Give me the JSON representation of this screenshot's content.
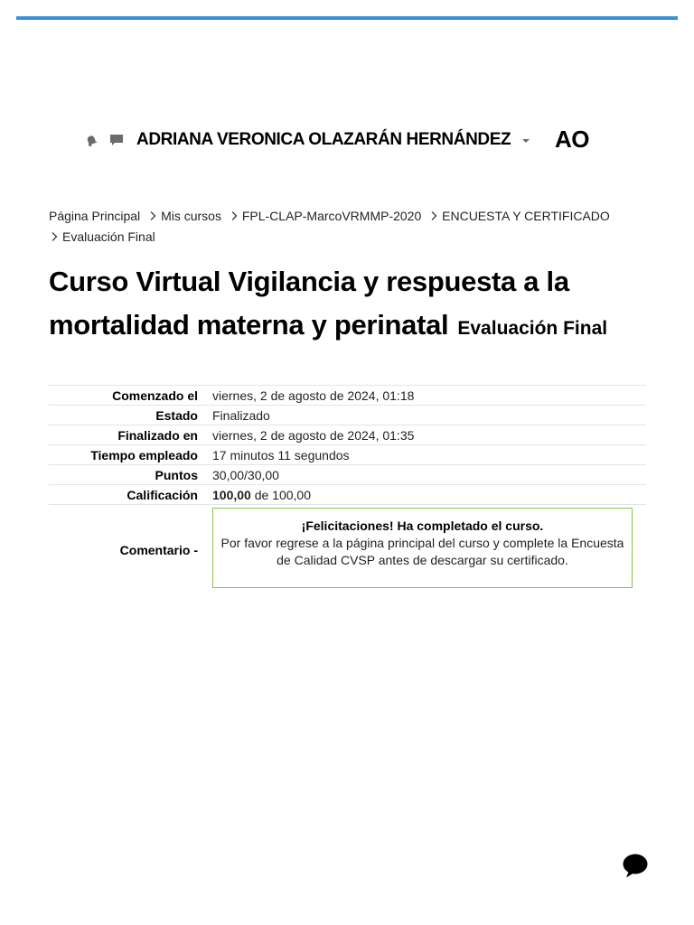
{
  "header": {
    "username": "ADRIANA VERONICA OLAZARÁN HERNÁNDEZ",
    "avatar_initials": "AO",
    "icons": [
      "bell-icon",
      "message-icon",
      "caret-down-icon"
    ],
    "accent_color": "#3b93d6"
  },
  "breadcrumb": {
    "items": [
      "Página Principal",
      "Mis cursos",
      "FPL-CLAP-MarcoVRMMP-2020",
      "ENCUESTA Y CERTIFICADO",
      "Evaluación Final"
    ]
  },
  "page": {
    "title": "Curso Virtual Vigilancia y respuesta a la mortalidad materna y perinatal",
    "subtitle": "Evaluación Final"
  },
  "summary": {
    "rows": [
      {
        "label": "Comenzado el",
        "value": "viernes, 2 de agosto de 2024, 01:18"
      },
      {
        "label": "Estado",
        "value": "Finalizado"
      },
      {
        "label": "Finalizado en",
        "value": "viernes, 2 de agosto de 2024, 01:35"
      },
      {
        "label": "Tiempo empleado",
        "value": "17 minutos 11 segundos"
      },
      {
        "label": "Puntos",
        "value": "30,00/30,00"
      }
    ],
    "grade": {
      "label": "Calificación",
      "score": "100,00",
      "suffix": " de 100,00"
    },
    "comment": {
      "label": "Comentario -",
      "title": "¡Felicitaciones! Ha completado el curso.",
      "body": "Por favor regrese a la página principal del curso y complete la Encuesta de Calidad CVSP antes de descargar su certificado.",
      "border_color": "#8bc34a"
    }
  },
  "chat": {
    "icon": "chat-bubble-icon"
  }
}
